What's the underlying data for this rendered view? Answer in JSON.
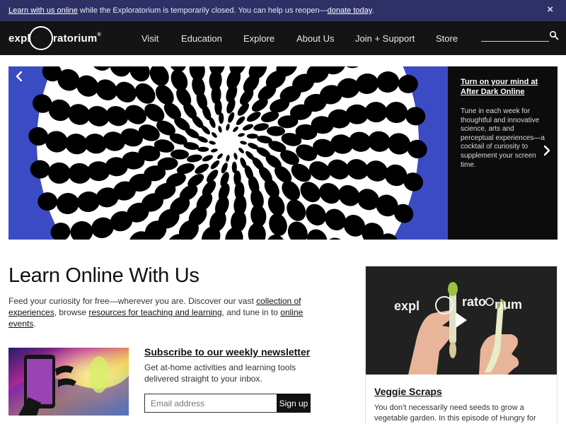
{
  "alert": {
    "link1": "Learn with us online",
    "text1": " while the Exploratorium is temporarily closed. You can help us reopen—",
    "link2": "donate today",
    "text2": ".",
    "close_symbol": "×"
  },
  "header": {
    "logo_left": "expl",
    "logo_right": "ratorium",
    "logo_reg": "®",
    "nav": [
      "Visit",
      "Education",
      "Explore",
      "About Us",
      "Join + Support",
      "Store"
    ],
    "search_icon": "search-icon"
  },
  "hero": {
    "prev_icon": "chevron-left-icon",
    "next_icon": "chevron-right-icon",
    "panel_title": "Turn on your mind at After Dark Online",
    "panel_desc": "Tune in each week for thoughtful and innovative science, arts and perceptual experiences—a cocktail of curiosity to supplement your screen time.",
    "colors": {
      "art_bg": "#3b4bc4",
      "panel_bg": "#0c0c0c"
    }
  },
  "learn": {
    "title": "Learn Online With Us",
    "t1": "Feed your curiosity for free—wherever you are. Discover our vast ",
    "l1": "collection of experiences",
    "t2": ", browse ",
    "l2": "resources for teaching and learning",
    "t3": ", and tune in to ",
    "l3": "online events",
    "t4": "."
  },
  "newsletter": {
    "title": "Subscribe to our weekly newsletter",
    "desc": "Get at-home activities and learning tools delivered straight to your inbox.",
    "email_placeholder": "Email address",
    "button": "Sign up"
  },
  "card": {
    "video_logo": "expl",
    "video_logo2": "rato",
    "video_logo3": "rium",
    "play_icon": "play-icon",
    "title": "Veggie Scraps",
    "desc": "You don’t necessarily need seeds to grow a vegetable garden. In this episode of Hungry for Science, learn to"
  }
}
